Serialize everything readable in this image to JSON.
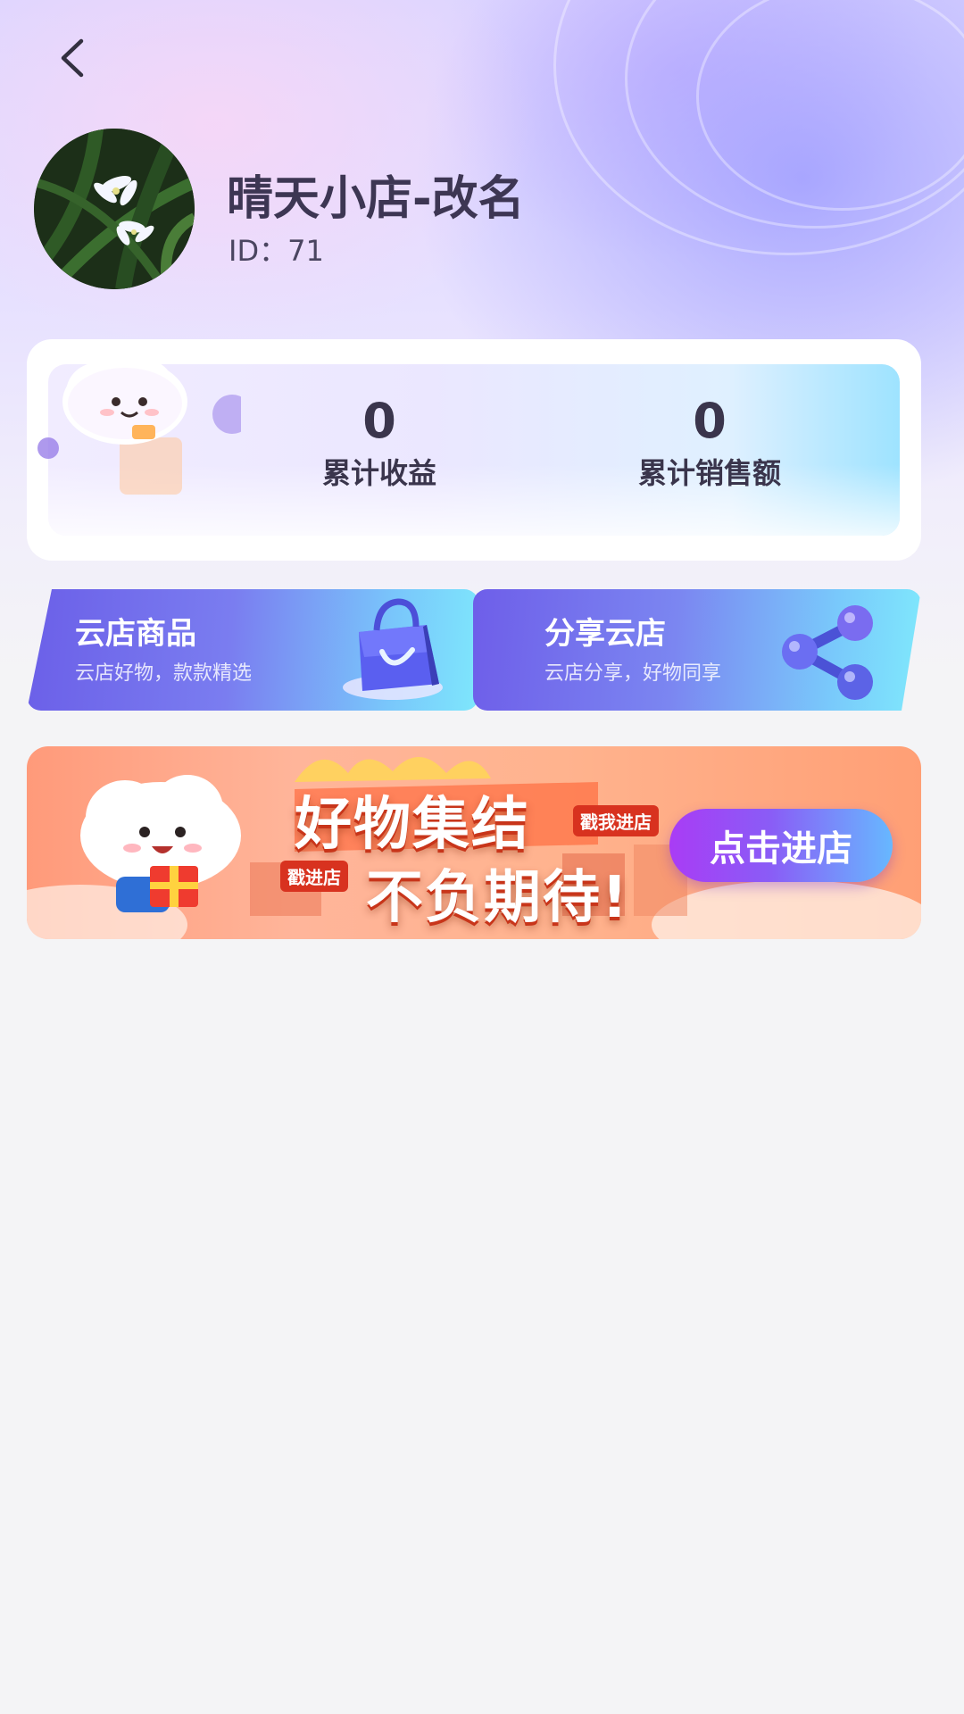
{
  "header": {
    "back_icon": "chevron-left-icon"
  },
  "shop": {
    "name": "晴天小店-改名",
    "id_text": "ID：71"
  },
  "stats": {
    "income_value": "0",
    "income_label": "累计收益",
    "sales_value": "0",
    "sales_label": "累计销售额"
  },
  "features": {
    "products_title": "云店商品",
    "products_sub": "云店好物，款款精选",
    "products_icon": "shopping-bag-icon",
    "share_title": "分享云店",
    "share_sub": "云店分享，好物同享",
    "share_icon": "share-icon"
  },
  "banner": {
    "line1": "好物集结",
    "line2": "不负期待!",
    "tag_a": "戳我进店",
    "tag_b": "戳进店",
    "button_label": "点击进店"
  },
  "colors": {
    "text_dark": "#3d3653",
    "card_bg": "#ffffff",
    "feature_start": "#6b63ea",
    "feature_end": "#79e2fb",
    "banner_orange": "#ff9a7a",
    "button_purple": "#a93cf5"
  }
}
